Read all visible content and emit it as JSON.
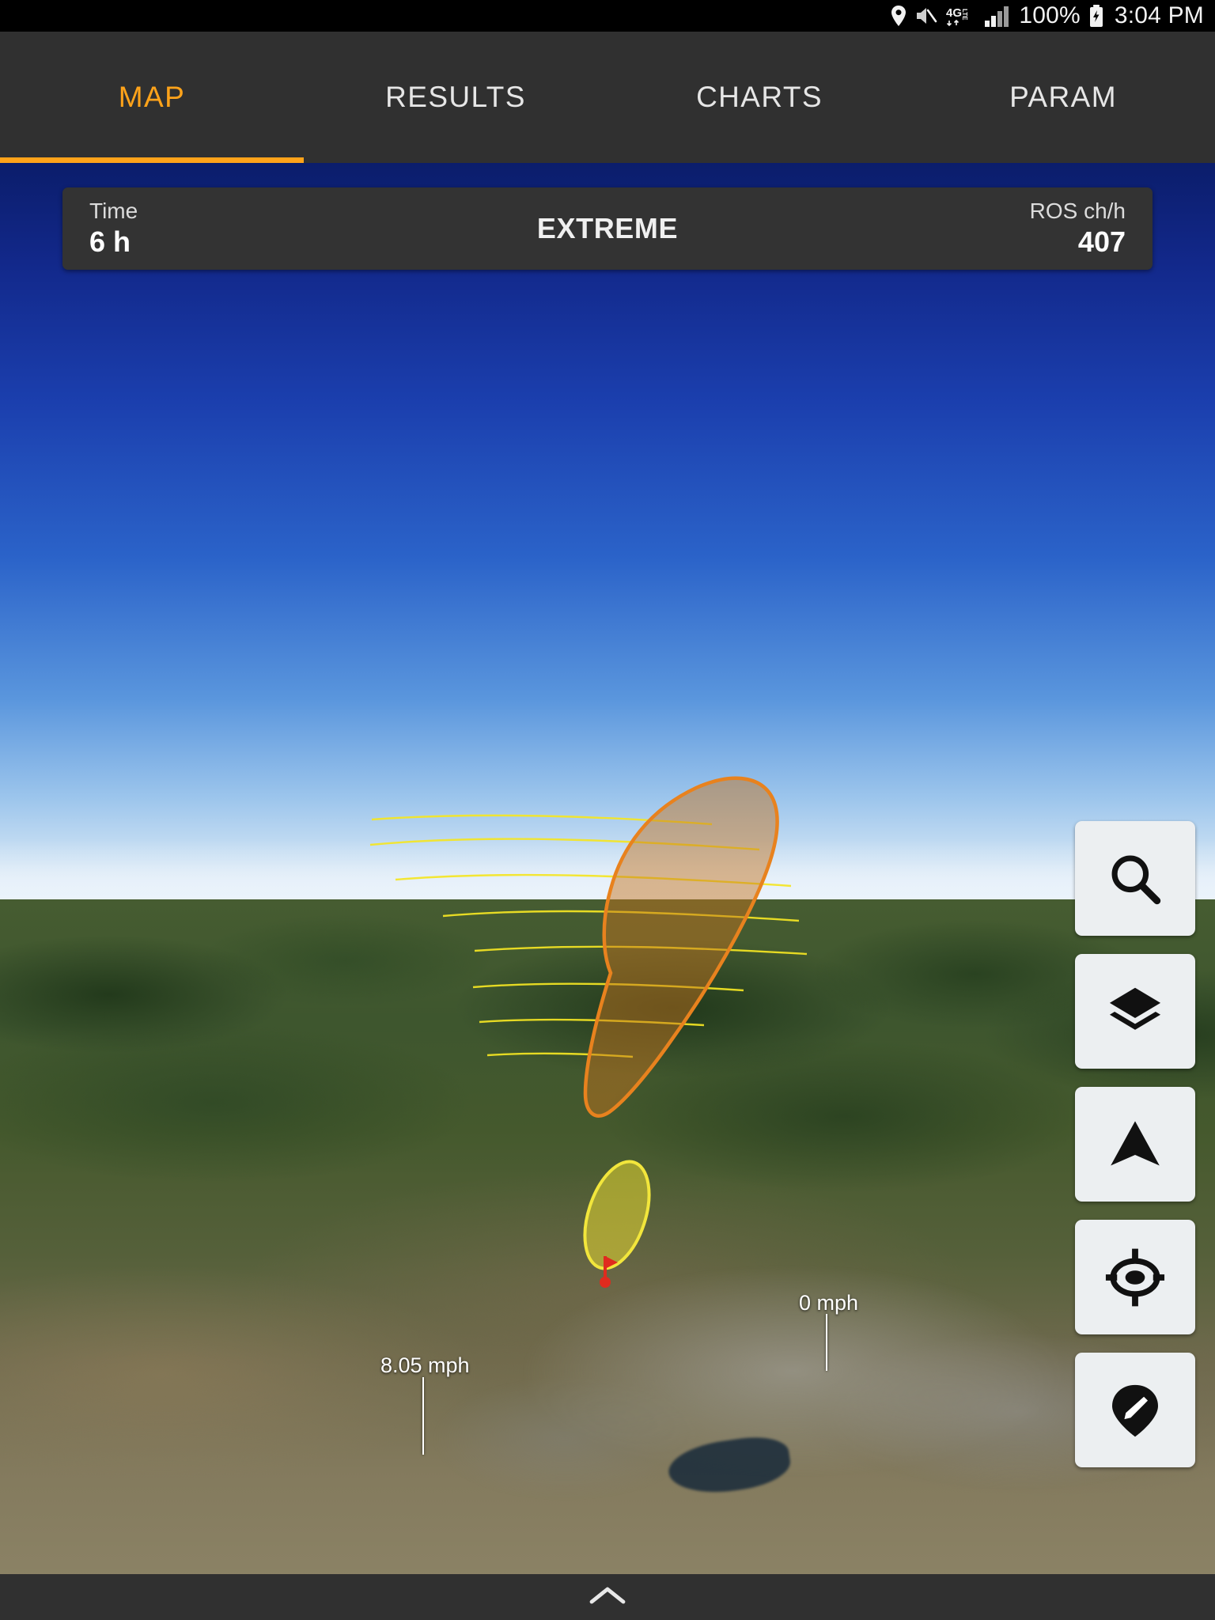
{
  "status_bar": {
    "icons": [
      "location-pin-icon",
      "volume-muted-icon",
      "4g-lte-icon",
      "signal-bars-icon",
      "battery-charging-icon"
    ],
    "network_label": "4G",
    "network_sub": "LTE",
    "battery_percent": "100%",
    "clock": "3:04 PM"
  },
  "tabs": [
    {
      "label": "MAP",
      "active": true
    },
    {
      "label": "RESULTS",
      "active": false
    },
    {
      "label": "CHARTS",
      "active": false
    },
    {
      "label": "PARAM",
      "active": false
    }
  ],
  "info_panel": {
    "time_label": "Time",
    "time_value": "6 h",
    "severity": "EXTREME",
    "ros_label": "ROS ch/h",
    "ros_value": "407"
  },
  "map_overlays": {
    "wind_labels": [
      {
        "text": "0 mph"
      },
      {
        "text": "8.05 mph"
      }
    ]
  },
  "map_controls": [
    {
      "name": "search-icon",
      "tooltip": "Search"
    },
    {
      "name": "layers-icon",
      "tooltip": "Layers"
    },
    {
      "name": "navigation-arrow-icon",
      "tooltip": "Navigation"
    },
    {
      "name": "my-location-icon",
      "tooltip": "My Location"
    },
    {
      "name": "marker-edit-icon",
      "tooltip": "Place Marker"
    }
  ],
  "bottom_bar": {
    "expand_icon": "chevron-up-icon"
  },
  "colors": {
    "accent": "#ffa31a",
    "panel_bg": "#333333",
    "tabbar_bg": "#303030",
    "fire_outer": "#e8821e",
    "fire_inner": "#f2e63c",
    "wind_vector": "#ffe100",
    "ignition_point": "#e02b1e"
  }
}
